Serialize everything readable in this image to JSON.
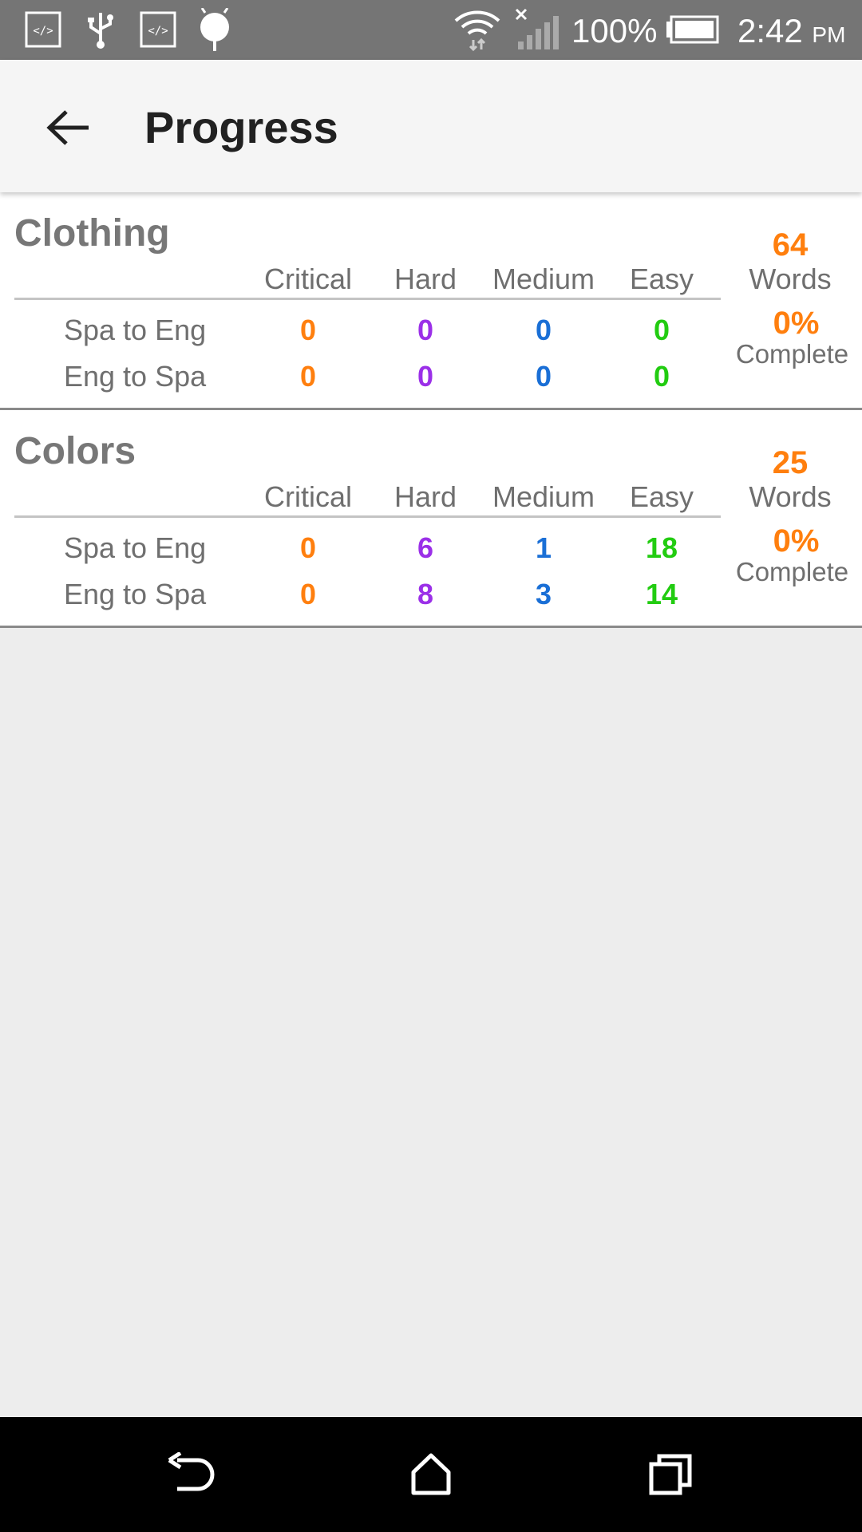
{
  "status_bar": {
    "icons": [
      "code-icon",
      "usb-icon",
      "code-icon",
      "android-debug-icon",
      "wifi-icon",
      "signal-icon",
      "battery-icon"
    ],
    "battery_percent": "100%",
    "time": "2:42",
    "time_suffix": "PM"
  },
  "app_bar": {
    "back_icon": "back-arrow-icon",
    "title": "Progress"
  },
  "colors": {
    "critical": "#ff7f0e",
    "hard": "#9b30e8",
    "medium": "#1a6fd6",
    "easy": "#22cc11"
  },
  "columns": [
    "Critical",
    "Hard",
    "Medium",
    "Easy"
  ],
  "categories": [
    {
      "name": "Clothing",
      "words_count": "64",
      "words_label": "Words",
      "percent": "0%",
      "percent_label": "Complete",
      "rows": [
        {
          "label": "Spa to Eng",
          "values": [
            "0",
            "0",
            "0",
            "0"
          ]
        },
        {
          "label": "Eng to Spa",
          "values": [
            "0",
            "0",
            "0",
            "0"
          ]
        }
      ]
    },
    {
      "name": "Colors",
      "words_count": "25",
      "words_label": "Words",
      "percent": "0%",
      "percent_label": "Complete",
      "rows": [
        {
          "label": "Spa to Eng",
          "values": [
            "0",
            "6",
            "1",
            "18"
          ]
        },
        {
          "label": "Eng to Spa",
          "values": [
            "0",
            "8",
            "3",
            "14"
          ]
        }
      ]
    }
  ],
  "nav_bar": {
    "icons": [
      "back-icon",
      "home-icon",
      "recents-icon"
    ]
  }
}
